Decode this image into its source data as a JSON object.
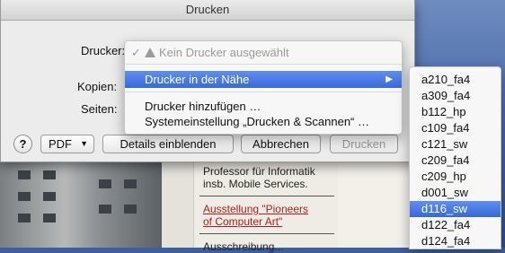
{
  "dialog": {
    "title": "Drucken",
    "printer_label": "Drucker:",
    "copies_label": "Kopien:",
    "pages_label": "Seiten:",
    "help_label": "?",
    "pdf_label": "PDF",
    "details_label": "Details einblenden",
    "cancel_label": "Abbrechen",
    "print_label": "Drucken"
  },
  "printer_menu": {
    "current": "Kein Drucker ausgewählt",
    "check": "✓",
    "nearby": "Drucker in der Nähe",
    "add_printer": "Drucker hinzufügen …",
    "system_prefs": "Systemeinstellung „Drucken & Scannen“ …"
  },
  "printers": [
    {
      "name": "a210_fa4",
      "selected": false
    },
    {
      "name": "a309_fa4",
      "selected": false
    },
    {
      "name": "b112_hp",
      "selected": false
    },
    {
      "name": "c109_fa4",
      "selected": false
    },
    {
      "name": "c121_sw",
      "selected": false
    },
    {
      "name": "c209_fa4",
      "selected": false
    },
    {
      "name": "c209_hp",
      "selected": false
    },
    {
      "name": "d001_sw",
      "selected": false
    },
    {
      "name": "d116_sw",
      "selected": true
    },
    {
      "name": "d122_fa4",
      "selected": false
    },
    {
      "name": "d124_fa4",
      "selected": false
    }
  ],
  "background": {
    "text1": "Professor für Informatik",
    "text1b": "insb. Mobile Services.",
    "link": "Ausstellung \"Pioneers",
    "link2": "of Computer Art\"",
    "text3": "Ausschreibung..."
  },
  "colors": {
    "highlight": "#3869d8",
    "link": "#b81c1c"
  }
}
